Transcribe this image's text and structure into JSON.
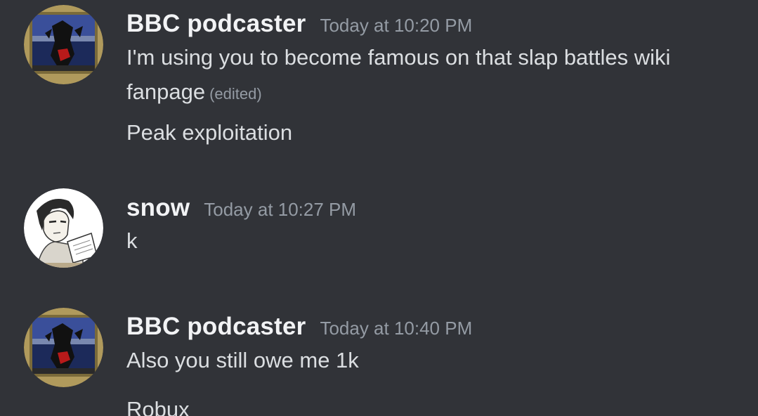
{
  "messages": [
    {
      "username": "BBC podcaster",
      "timestamp": "Today at 10:20 PM",
      "avatar_icon": "comic-hero-avatar-icon",
      "lines": [
        {
          "text": "I'm using you to become famous on that slap battles wiki"
        },
        {
          "text": "fanpage",
          "edited_label": "(edited)"
        },
        {
          "text": "Peak exploitation"
        }
      ]
    },
    {
      "username": "snow",
      "timestamp": "Today at 10:27 PM",
      "avatar_icon": "sketch-character-avatar-icon",
      "lines": [
        {
          "text": "k"
        }
      ]
    },
    {
      "username": "BBC podcaster",
      "timestamp": "Today at 10:40 PM",
      "avatar_icon": "comic-hero-avatar-icon",
      "lines": [
        {
          "text": "Also you still owe me 1k"
        },
        {
          "text": "Robux"
        }
      ]
    }
  ],
  "colors": {
    "background": "#313338",
    "username": "#f2f3f5",
    "message_text": "#dbdee1",
    "muted": "#949ba4"
  }
}
